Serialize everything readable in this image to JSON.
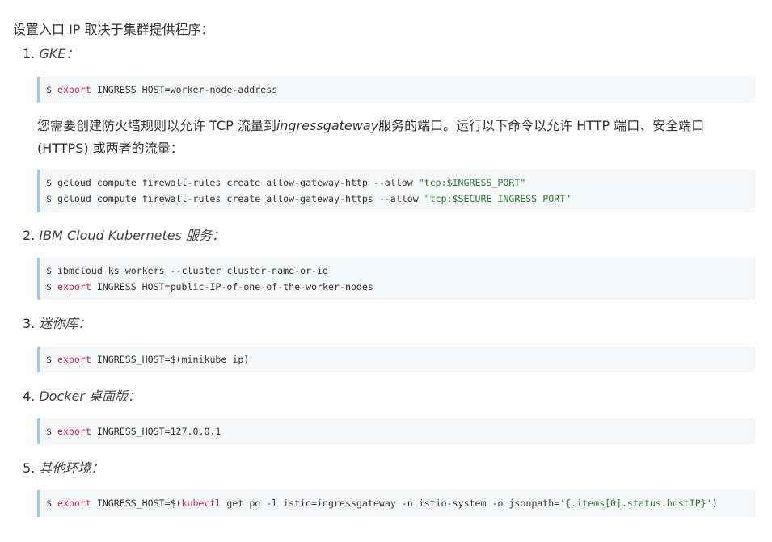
{
  "intro": "设置入口 IP 取决于集群提供程序：",
  "items": [
    {
      "number": "1.",
      "title": "GKE：",
      "code_lines": [
        {
          "prompt": "$ ",
          "kw": "export",
          "rest": " INGRESS_HOST=worker-node-address"
        }
      ],
      "note": {
        "before": "您需要创建防火墙规则以允许 TCP 流量到",
        "emphasis": "ingressgateway",
        "after": "服务的端口。运行以下命令以允许 HTTP 端口、安全端口 (HTTPS) 或两者的流量："
      },
      "code_lines_2": [
        {
          "prefix": "$ gcloud compute firewall-rules create allow-gateway-http --allow ",
          "str": "\"tcp:$INGRESS_PORT\""
        },
        {
          "prefix": "$ gcloud compute firewall-rules create allow-gateway-https --allow ",
          "str": "\"tcp:$SECURE_INGRESS_PORT\""
        }
      ]
    },
    {
      "number": "2.",
      "title": "IBM Cloud Kubernetes 服务：",
      "code_lines": [
        {
          "prompt": "$ ibmcloud ks workers --cluster cluster-name-or-id",
          "kw": "",
          "rest": ""
        },
        {
          "prompt": "$ ",
          "kw": "export",
          "rest": " INGRESS_HOST=public-IP-of-one-of-the-worker-nodes"
        }
      ]
    },
    {
      "number": "3.",
      "title": "迷你库：",
      "code_lines": [
        {
          "prompt": "$ ",
          "kw": "export",
          "rest": " INGRESS_HOST=$(minikube ip)"
        }
      ]
    },
    {
      "number": "4.",
      "title": "Docker 桌面版：",
      "code_lines": [
        {
          "prompt": "$ ",
          "kw": "export",
          "rest": " INGRESS_HOST=127.0.0.1"
        }
      ]
    },
    {
      "number": "5.",
      "title": "其他环境：",
      "code_parts": {
        "a": "$ ",
        "kw1": "export",
        "b": " INGRESS_HOST=$(",
        "kw2": "kubectl",
        "c": " get po -l istio=ingressgateway -n istio-system -o jsonpath=",
        "str": "'{.items[0].status.hostIP}'",
        "d": ")"
      }
    }
  ]
}
